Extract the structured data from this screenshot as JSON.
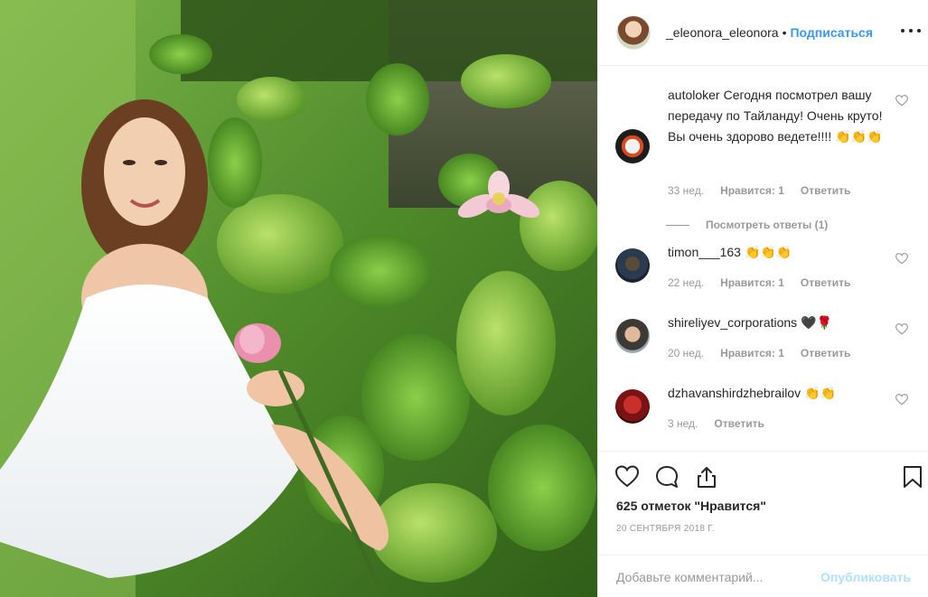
{
  "post": {
    "author": "_eleonora_eleonora",
    "separator": "•",
    "follow_label": "Подписаться"
  },
  "comments": [
    {
      "user": "autoloker",
      "text": "Сегодня посмотрел вашу передачу по Тайланду! Очень круто! Вы очень здорово ведете!!!! 👏👏👏",
      "age": "33 нед.",
      "likes_label": "Нравится: 1",
      "reply_label": "Ответить",
      "view_replies_label": "Посмотреть ответы (1)"
    },
    {
      "user": "timon___163",
      "text": "👏👏👏",
      "age": "22 нед.",
      "likes_label": "Нравится: 1",
      "reply_label": "Ответить"
    },
    {
      "user": "shireliyev_corporations",
      "text": "🖤🌹",
      "age": "20 нед.",
      "likes_label": "Нравится: 1",
      "reply_label": "Ответить"
    },
    {
      "user": "dzhavanshirdzhebrailov",
      "text": "👏👏",
      "age": "3 нед.",
      "reply_label": "Ответить"
    }
  ],
  "likes_text": "625 отметок \"Нравится\"",
  "date_text": "20 СЕНТЯБРЯ 2018 Г.",
  "add_comment": {
    "placeholder": "Добавьте комментарий...",
    "publish_label": "Опубликовать"
  },
  "icons": {
    "like": "heart-icon",
    "comment": "comment-bubble-icon",
    "share": "share-icon",
    "save": "bookmark-icon",
    "more": "more-dots-icon"
  },
  "colors": {
    "accent": "#3897f0",
    "muted": "#999999",
    "publish_disabled": "#b2dffc"
  }
}
